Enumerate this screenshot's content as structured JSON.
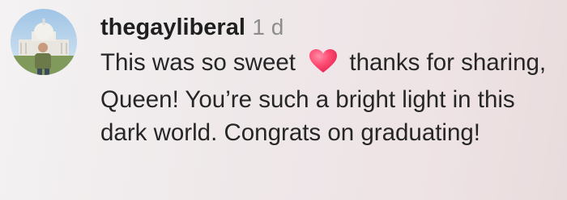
{
  "comment": {
    "username": "thegayliberal",
    "timestamp": "1 d",
    "avatar_icon": "user-avatar-photo",
    "text_part1": "This was so sweet",
    "emoji": "heart-emoji",
    "text_part2": "thanks for sharing, Queen! You’re such a bright light in this dark world. Congrats on graduating!",
    "colors": {
      "username": "#1f1f1f",
      "timestamp": "#8d8d8d",
      "text": "#262626",
      "heart": "#ff3b6b"
    }
  }
}
